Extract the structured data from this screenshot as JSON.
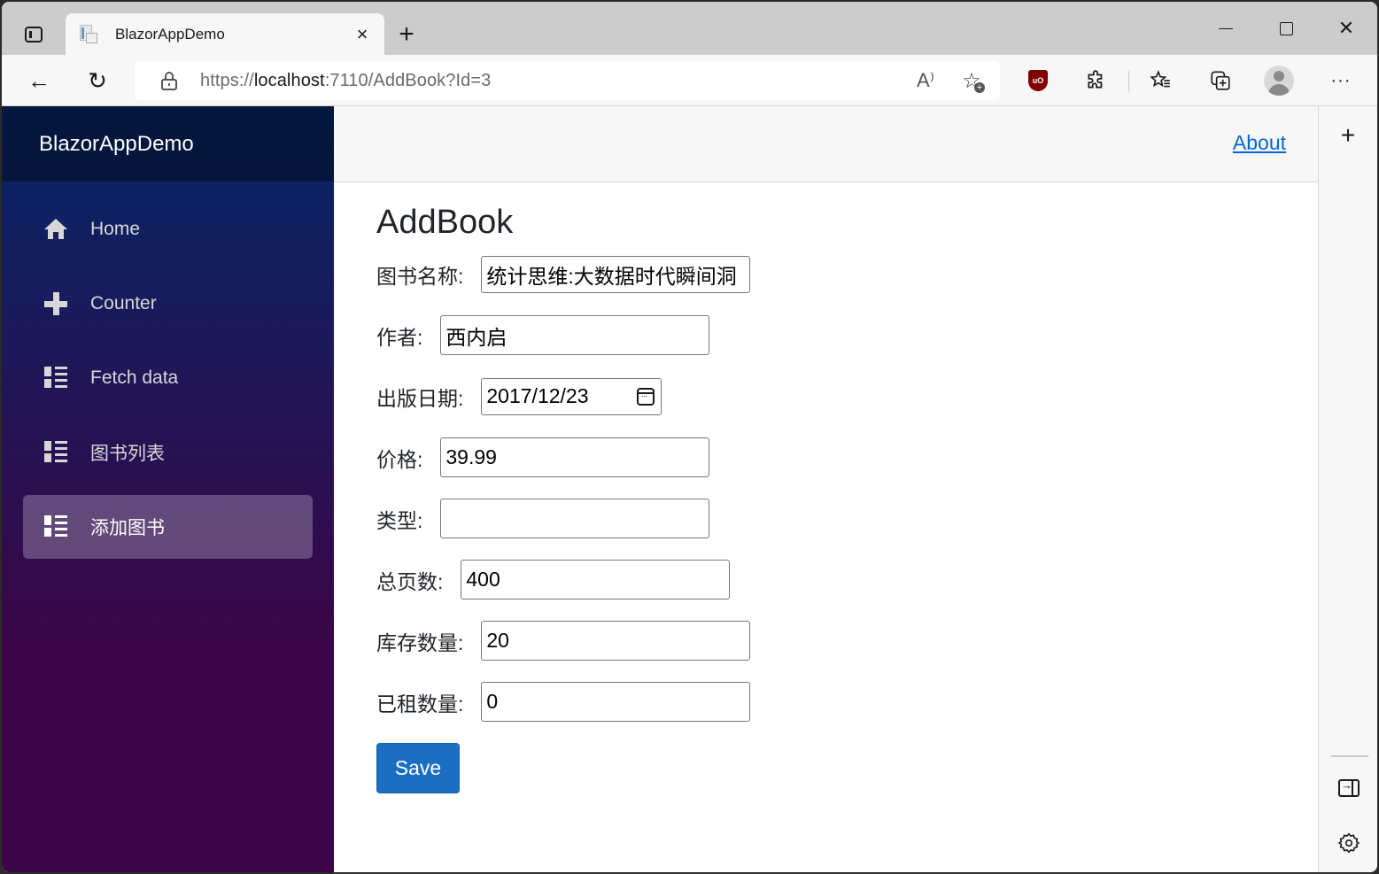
{
  "browser": {
    "tab": {
      "title": "BlazorAppDemo",
      "close_icon": "×"
    },
    "new_tab_icon": "+",
    "window_controls": {
      "minimize": "minimize",
      "maximize": "maximize",
      "close": "✕"
    },
    "toolbar": {
      "back_icon": "←",
      "reload_icon": "↻",
      "url": {
        "scheme": "https://",
        "host": "localhost",
        "rest": ":7110/AddBook?Id=3"
      },
      "read_aloud_icon": "A⁾",
      "favorite_icon": "☆",
      "ublock_label": "uO",
      "extensions_icon": "⚙",
      "favorites_icon": "☆≡",
      "collections_icon": "⧉",
      "more_icon": "···"
    },
    "edge_sidebar": {
      "add_icon": "+",
      "settings_icon": "⚙"
    }
  },
  "app": {
    "brand": "BlazorAppDemo",
    "nav": [
      {
        "label": "Home",
        "icon": "home-icon",
        "active": false
      },
      {
        "label": "Counter",
        "icon": "plus-icon",
        "active": false
      },
      {
        "label": "Fetch data",
        "icon": "list-icon",
        "active": false
      },
      {
        "label": "图书列表",
        "icon": "list-icon",
        "active": false
      },
      {
        "label": "添加图书",
        "icon": "list-icon",
        "active": true
      }
    ],
    "topbar": {
      "about_label": "About"
    },
    "page": {
      "title": "AddBook",
      "fields": {
        "name": {
          "label": "图书名称:",
          "value": "统计思维:大数据时代瞬间洞"
        },
        "author": {
          "label": "作者:",
          "value": "西内启"
        },
        "publish_date": {
          "label": "出版日期:",
          "value": "2017/12/23"
        },
        "price": {
          "label": "价格:",
          "value": "39.99"
        },
        "type": {
          "label": "类型:",
          "value": ""
        },
        "total_pages": {
          "label": "总页数:",
          "value": "400"
        },
        "stock": {
          "label": "库存数量:",
          "value": "20"
        },
        "rented": {
          "label": "已租数量:",
          "value": "0"
        }
      },
      "save_label": "Save"
    }
  },
  "colors": {
    "sidebar_top": "#052767",
    "sidebar_bottom": "#3a0647",
    "primary_button": "#1b6ec2",
    "link": "#0366d6"
  }
}
